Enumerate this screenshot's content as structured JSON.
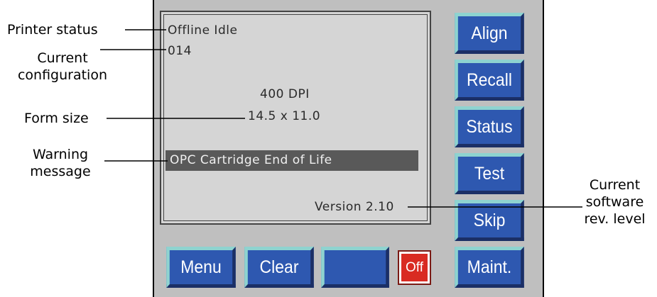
{
  "annotations": {
    "printer_status": "Printer status",
    "current_configuration_line1": "Current",
    "current_configuration_line2": "configuration",
    "form_size": "Form size",
    "warning_message_line1": "Warning",
    "warning_message_line2": "message",
    "software_rev_line1": "Current",
    "software_rev_line2": "software",
    "software_rev_line3": "rev. level"
  },
  "lcd": {
    "status": "Offline Idle",
    "configuration": "014",
    "resolution": "400 DPI",
    "form_size": "14.5 x 11.0",
    "warning": "OPC Cartridge End of Life",
    "version": "Version 2.10"
  },
  "side_buttons": {
    "align": "Align",
    "recall": "Recall",
    "status": "Status",
    "test": "Test",
    "skip": "Skip",
    "maint": "Maint."
  },
  "bottom_buttons": {
    "menu": "Menu",
    "clear": "Clear",
    "blank": "",
    "off": "Off"
  },
  "colors": {
    "button_blue": "#2e58b0",
    "button_highlight": "#8ed3d0",
    "off_red": "#d92b22",
    "panel_gray": "#bfbfbf",
    "lcd_bg": "#d5d5d5",
    "warning_bg": "#595959"
  }
}
